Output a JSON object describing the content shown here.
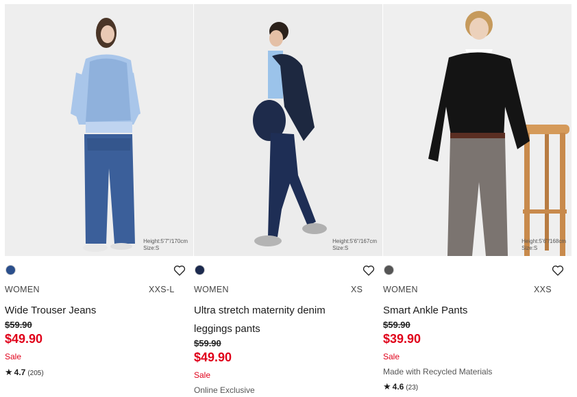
{
  "products": [
    {
      "swatch_color": "#2b4f8c",
      "gender": "WOMEN",
      "size_range": "XXS-L",
      "name": "Wide Trouser Jeans",
      "original_price": "$59.90",
      "sale_price": "$49.90",
      "sale_label": "Sale",
      "rating": "4.7",
      "review_count": "(205)",
      "model_height": "Height:5'7\"/170cm",
      "model_size": "Size:S",
      "favorite_icon": "heart-icon"
    },
    {
      "swatch_color": "#1c2a4e",
      "gender": "WOMEN",
      "size_range": "XS",
      "name": "Ultra stretch maternity denim leggings pants",
      "original_price": "$59.90",
      "sale_price": "$49.90",
      "sale_label": "Sale",
      "note": "Online Exclusive",
      "model_height": "Height:5'6\"/167cm",
      "model_size": "Size:S",
      "favorite_icon": "heart-icon"
    },
    {
      "swatch_color": "#555555",
      "gender": "WOMEN",
      "size_range": "XXS",
      "name": "Smart Ankle Pants",
      "original_price": "$59.90",
      "sale_price": "$39.90",
      "sale_label": "Sale",
      "note": "Made with Recycled Materials",
      "rating": "4.6",
      "review_count": "(23)",
      "model_height": "Height:5'6\"/168cm",
      "model_size": "Size:S",
      "favorite_icon": "heart-icon"
    }
  ],
  "colors": {
    "sale_red": "#e0001a",
    "text": "#1b1b1b",
    "photo_bg": "#ededed"
  }
}
